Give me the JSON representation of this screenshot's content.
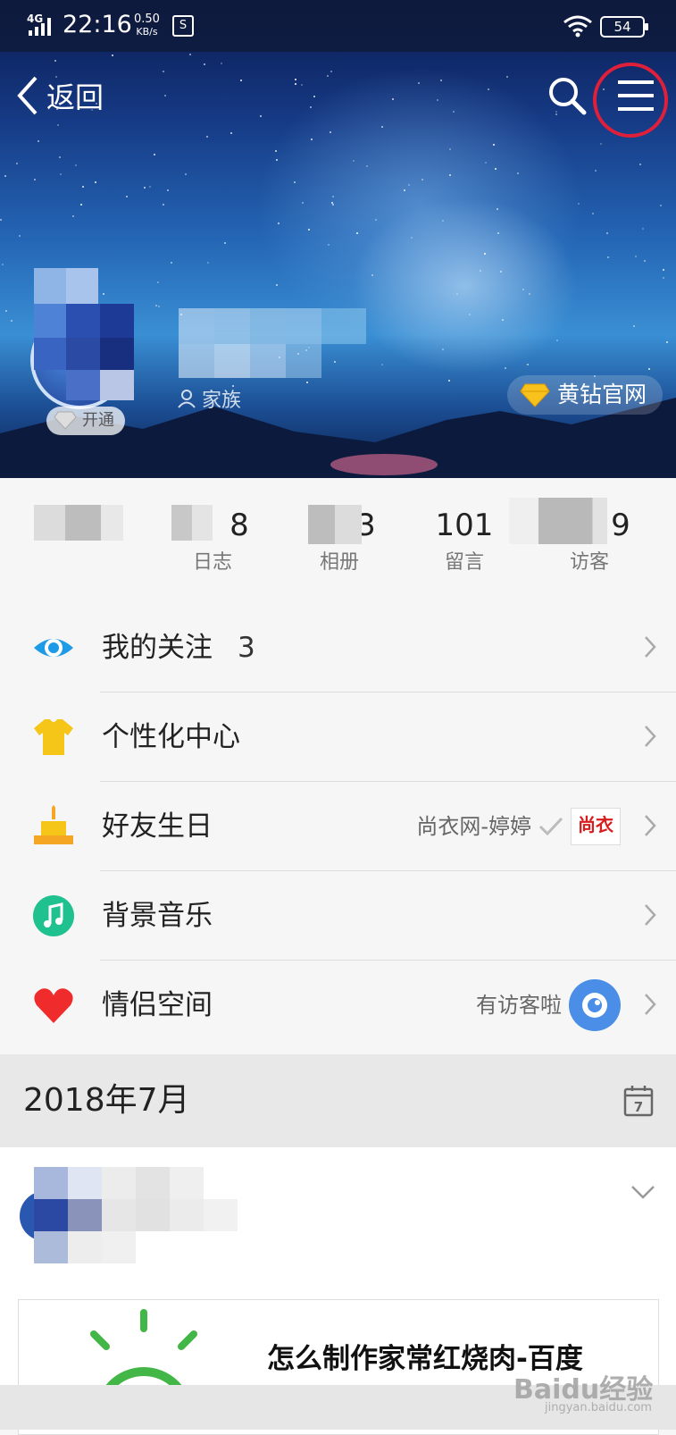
{
  "status_bar": {
    "network": "4G",
    "time": "22:16",
    "speed_value": "0.50",
    "speed_unit": "KB/s",
    "battery": "54"
  },
  "header": {
    "back_label": "返回"
  },
  "profile": {
    "open_badge": "开通",
    "family_label": "家族",
    "gold_link": "黄钻官网"
  },
  "stats": [
    {
      "value": "",
      "label": ""
    },
    {
      "value": "8",
      "label": "日志"
    },
    {
      "value": "3",
      "label": "相册"
    },
    {
      "value": "101",
      "label": "留言"
    },
    {
      "value": "9",
      "label": "访客"
    }
  ],
  "menu": [
    {
      "label": "我的关注",
      "count": "3",
      "icon": "eye-icon",
      "color": "#1e9be6"
    },
    {
      "label": "个性化中心",
      "icon": "tshirt-icon",
      "color": "#f5c518"
    },
    {
      "label": "好友生日",
      "icon": "cake-icon",
      "color": "#f5a623",
      "extra": "尚衣网-婷婷",
      "extra_logo": "尚衣"
    },
    {
      "label": "背景音乐",
      "icon": "music-note-icon",
      "color": "#1fc18f"
    },
    {
      "label": "情侣空间",
      "icon": "heart-icon",
      "color": "#f02b2b",
      "extra": "有访客啦"
    }
  ],
  "month": {
    "label": "2018年7月",
    "calendar_day": "7"
  },
  "feed": {
    "card_title": "怎么制作家常红烧肉-百度"
  },
  "watermark": {
    "text": "Baidu经验",
    "sub": "jingyan.baidu.com"
  }
}
